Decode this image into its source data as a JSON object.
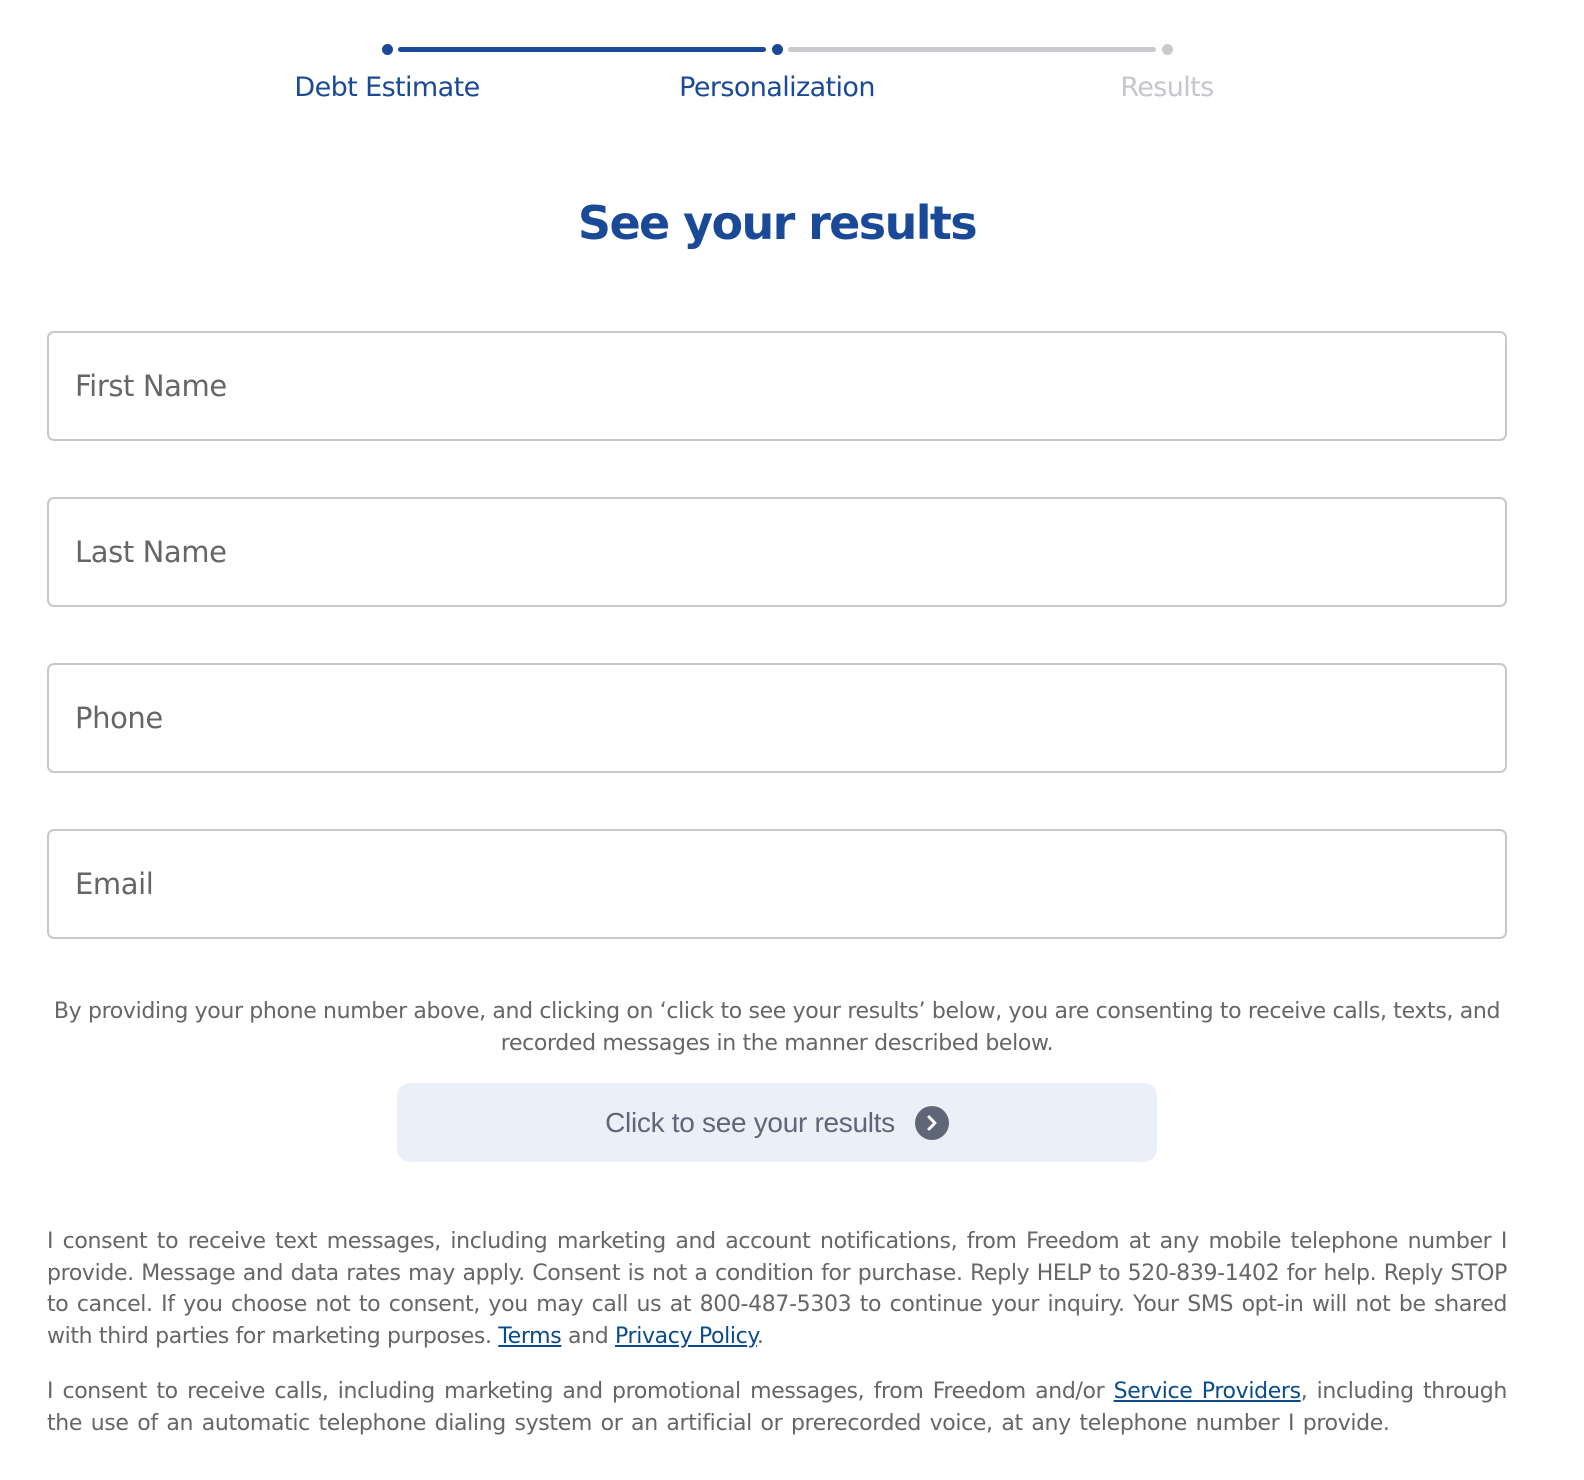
{
  "stepper": {
    "progress_steps_completed": 2,
    "total_steps": 3,
    "steps": [
      {
        "label": "Debt Estimate",
        "state": "complete"
      },
      {
        "label": "Personalization",
        "state": "current"
      },
      {
        "label": "Results",
        "state": "upcoming"
      }
    ]
  },
  "colors": {
    "brand_blue": "#1a4a97",
    "inactive_gray": "#c9cace",
    "link_blue": "#0b4b8c",
    "button_bg": "#ebeff8",
    "button_text": "#5f6677"
  },
  "page_title": "See your results",
  "form": {
    "first_name": {
      "placeholder": "First Name",
      "value": ""
    },
    "last_name": {
      "placeholder": "Last Name",
      "value": ""
    },
    "phone": {
      "placeholder": "Phone",
      "value": ""
    },
    "email": {
      "placeholder": "Email",
      "value": ""
    }
  },
  "disclaimer": "By providing your phone number above, and clicking on ‘click to see your results’ below, you are consenting to receive calls, texts, and recorded messages in the manner described below.",
  "submit": {
    "label": "Click to see your results",
    "icon": "chevron-right-circle-icon"
  },
  "consent_sms": {
    "text": "I consent to receive text messages, including marketing and account notifications, from Freedom at any mobile telephone number I provide. Message and data rates may apply. Consent is not a condition for purchase. Reply HELP to 520-839-1402 for help. Reply STOP to cancel. If you choose not to consent, you may call us at 800-487-5303 to continue your inquiry. Your SMS opt-in will not be shared with third parties for marketing purposes. ",
    "terms_link": "Terms",
    "and": " and ",
    "privacy_link": "Privacy Policy",
    "end": "."
  },
  "consent_calls": {
    "text_before": "I consent to receive calls, including marketing and promotional messages, from Freedom and/or ",
    "service_providers_link": "Service Providers",
    "text_after": ", including through the use of an automatic telephone dialing system or an artificial or prerecorded voice, at any telephone number I provide."
  }
}
